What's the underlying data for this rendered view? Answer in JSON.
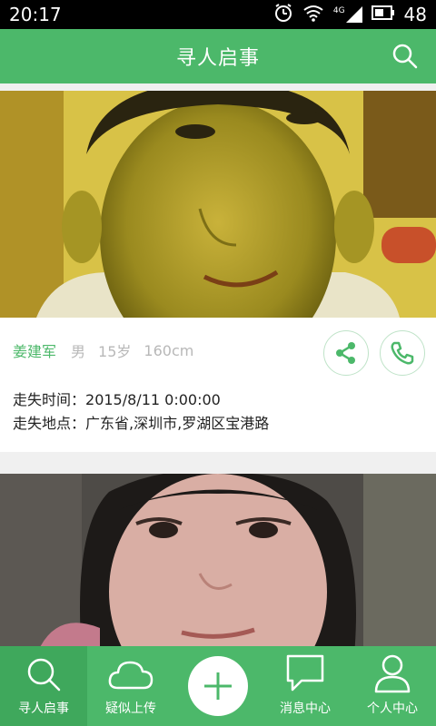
{
  "status_bar": {
    "time": "20:17",
    "network": "4G",
    "battery": "48"
  },
  "app_bar": {
    "title": "寻人启事"
  },
  "cards": [
    {
      "name": "姜建军",
      "gender": "男",
      "age": "15岁",
      "height": "160cm",
      "missing_time_label": "走失时间：",
      "missing_time": "2015/8/11 0:00:00",
      "missing_place_label": "走失地点：",
      "missing_place": "广东省,深圳市,罗湖区宝港路"
    }
  ],
  "bottom_nav": [
    {
      "label": "寻人启事",
      "icon": "search-icon"
    },
    {
      "label": "疑似上传",
      "icon": "cloud-icon"
    },
    {
      "label": "",
      "icon": "plus-icon"
    },
    {
      "label": "消息中心",
      "icon": "message-icon"
    },
    {
      "label": "个人中心",
      "icon": "user-icon"
    }
  ],
  "colors": {
    "primary": "#4cb86a",
    "primary_dark": "#3fa85c"
  }
}
